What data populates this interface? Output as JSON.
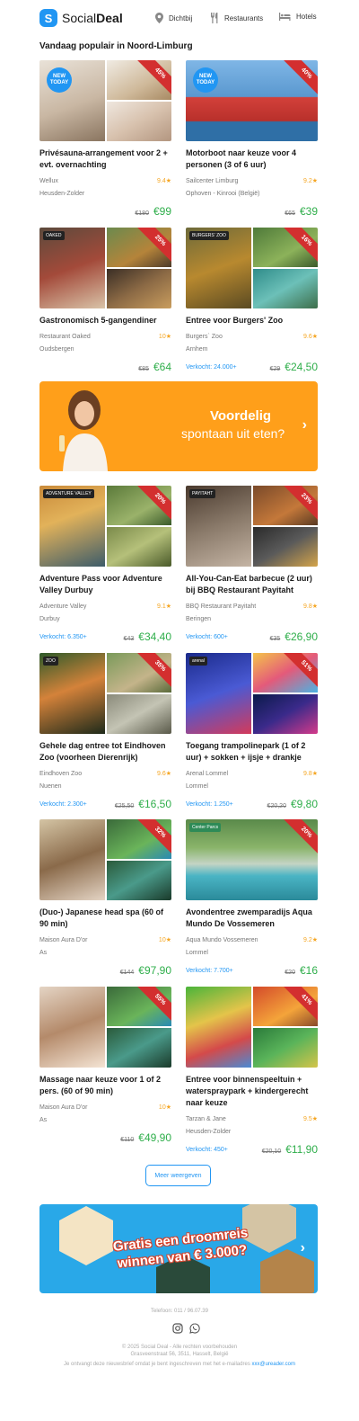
{
  "header": {
    "logo_text_a": "Social",
    "logo_text_b": "Deal",
    "nav": [
      "Dichtbij",
      "Restaurants",
      "Hotels"
    ]
  },
  "section_title": "Vandaag populair in Noord-Limburg",
  "deals": [
    {
      "title": "Privésauna-arrangement voor 2 + evt. overnachting",
      "merchant": "Wellux",
      "location": "Heusden-Zolder",
      "rating": "9.4",
      "sold": "",
      "old_price": "€180",
      "new_price": "€99",
      "discount": "45%",
      "new_today": "NEW TODAY"
    },
    {
      "title": "Motorboot naar keuze voor 4 personen (3 of 6 uur)",
      "merchant": "Sailcenter Limburg",
      "location": "Ophoven - Kinrooi (België)",
      "rating": "9.2",
      "sold": "",
      "old_price": "€65",
      "new_price": "€39",
      "discount": "40%",
      "new_today": "NEW TODAY"
    },
    {
      "title": "Gastronomisch 5-gangendiner",
      "merchant": "Restaurant Oaked",
      "location": "Oudsbergen",
      "rating": "10",
      "sold": "",
      "old_price": "€85",
      "new_price": "€64",
      "discount": "25%",
      "brand": "OAKED"
    },
    {
      "title": "Entree voor Burgers' Zoo",
      "merchant": "Burgers` Zoo",
      "location": "Arnhem",
      "rating": "9.6",
      "sold": "Verkocht: 24.000+",
      "old_price": "€29",
      "new_price": "€24,50",
      "discount": "16%",
      "brand": "BURGERS' ZOO"
    },
    {
      "title": "Adventure Pass voor Adventure Valley Durbuy",
      "merchant": "Adventure Valley",
      "location": "Durbuy",
      "rating": "9.1",
      "sold": "Verkocht: 6.350+",
      "old_price": "€43",
      "new_price": "€34,40",
      "discount": "20%",
      "brand": "ADVENTURE VALLEY"
    },
    {
      "title": "All-You-Can-Eat barbecue (2 uur) bij BBQ Restaurant Payitaht",
      "merchant": "BBQ Restaurant Payitaht",
      "location": "Beringen",
      "rating": "9.8",
      "sold": "Verkocht: 600+",
      "old_price": "€35",
      "new_price": "€26,90",
      "discount": "23%",
      "brand": "PAYITAHT"
    },
    {
      "title": "Gehele dag entree tot Eindhoven Zoo (voorheen Dierenrijk)",
      "merchant": "Eindhoven Zoo",
      "location": "Nuenen",
      "rating": "9.6",
      "sold": "Verkocht: 2.300+",
      "old_price": "€25,50",
      "new_price": "€16,50",
      "discount": "35%",
      "brand": "ZOO"
    },
    {
      "title": "Toegang trampolinepark (1 of 2 uur) + sokken + ijsje + drankje",
      "merchant": "Arenal Lommel",
      "location": "Lommel",
      "rating": "9.8",
      "sold": "Verkocht: 1.250+",
      "old_price": "€20,20",
      "new_price": "€9,80",
      "discount": "51%",
      "brand": "arenal"
    },
    {
      "title": "(Duo-) Japanese head spa (60 of 90 min)",
      "merchant": "Maison Aura D'or",
      "location": "As",
      "rating": "10",
      "sold": "",
      "old_price": "€144",
      "new_price": "€97,90",
      "discount": "32%"
    },
    {
      "title": "Avondentree zwemparadijs Aqua Mundo De Vossemeren",
      "merchant": "Aqua Mundo Vossemeren",
      "location": "Lommel",
      "rating": "9.2",
      "sold": "Verkocht: 7.700+",
      "old_price": "€20",
      "new_price": "€16",
      "discount": "20%",
      "brand": "Center Parcs"
    },
    {
      "title": "Massage naar keuze voor 1 of 2 pers. (60 of 90 min)",
      "merchant": "Maison Aura D'or",
      "location": "As",
      "rating": "10",
      "sold": "",
      "old_price": "€110",
      "new_price": "€49,90",
      "discount": "55%"
    },
    {
      "title": "Entree voor binnenspeeltuin + waterspraypark + kindergerecht naar keuze",
      "merchant": "Tarzan & Jane",
      "location": "Heusden-Zolder",
      "rating": "9.5",
      "sold": "Verkocht: 450+",
      "old_price": "€20,10",
      "new_price": "€11,90",
      "discount": "41%"
    }
  ],
  "banner1": {
    "line1": "Voordelig",
    "line2": "spontaan uit eten?"
  },
  "more_button": "Meer weergeven",
  "banner2": {
    "line1": "Gratis een droomreis",
    "line2": "winnen van € 3.000?"
  },
  "footer": {
    "phone": "Telefoon: 011 / 96.07.39",
    "copyright": "© 2025 Social Deal - Alle rechten voorbehouden",
    "address": "Grasveenstraat 56, 3511, Hasselt, België",
    "note": "Je ontvangt deze nieuwsbrief omdat je bent ingeschreven met het e-mailadres",
    "email": "xxx@ureader.com"
  },
  "colors": {
    "brand_blue": "#2196f3",
    "price_green": "#2eae4a",
    "discount_red": "#d32f2f",
    "rating_gold": "#f5a623",
    "banner_orange": "#ff9f1a"
  },
  "icons": [
    "location-pin-icon",
    "cutlery-icon",
    "bed-icon",
    "star-icon",
    "arrow-right-icon",
    "instagram-icon",
    "whatsapp-icon"
  ]
}
